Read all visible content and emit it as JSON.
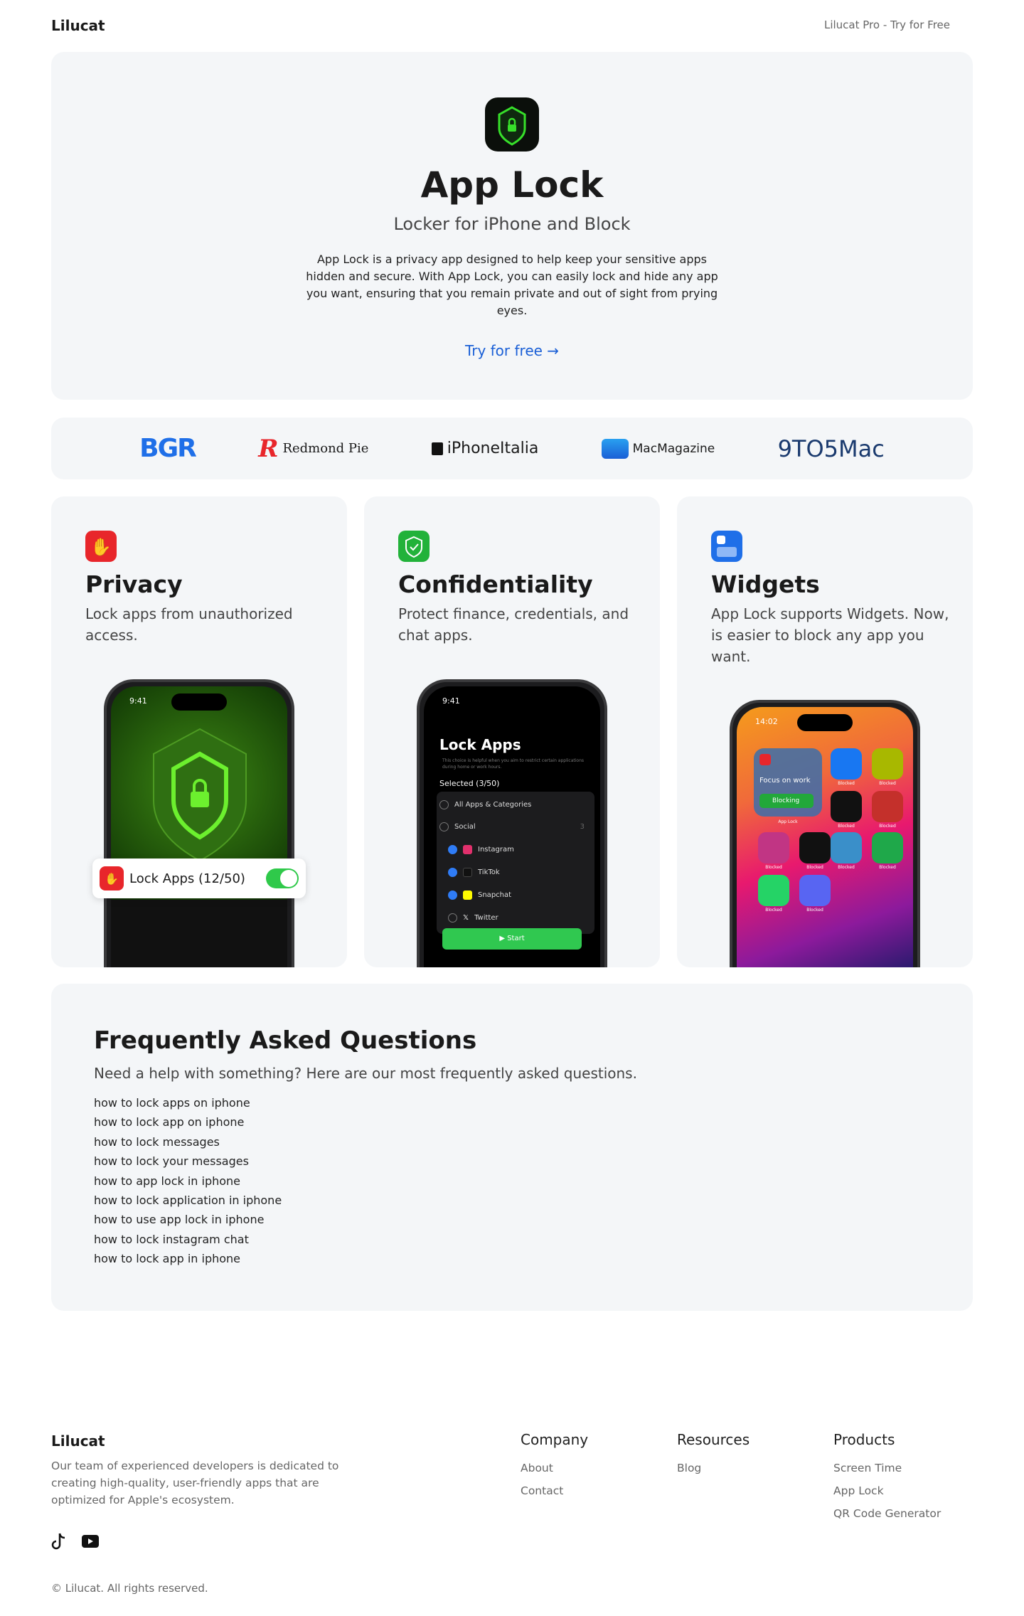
{
  "header": {
    "brand": "Lilucat",
    "pro_link": "Lilucat Pro - Try for Free"
  },
  "hero": {
    "title": "App Lock",
    "subtitle": "Locker for iPhone and Block",
    "description": "App Lock is a privacy app designed to help keep your sensitive apps hidden and secure. With App Lock, you can easily lock and hide any app you want, ensuring that you remain private and out of sight from prying eyes.",
    "cta": "Try for free →",
    "icon": "shield-lock-icon",
    "accent": "#1a5fd6"
  },
  "press_logos": [
    "BGR",
    "Redmond Pie",
    "iPhoneItalia",
    "MacMagazine",
    "9TO5Mac"
  ],
  "features": [
    {
      "title": "Privacy",
      "description": "Lock apps from unauthorized access.",
      "icon": "hand-stop-icon",
      "color": "#e8262b",
      "phone": {
        "time": "9:41",
        "toggle_label": "Lock Apps (12/50)",
        "toggle_on": true
      }
    },
    {
      "title": "Confidentiality",
      "description": "Protect finance, credentials, and chat apps.",
      "icon": "shield-check-icon",
      "color": "#22b23a",
      "phone": {
        "time": "9:41",
        "heading": "Lock Apps",
        "note": "This choice is helpful when you aim to restrict certain applications during home or work hours.",
        "selected": "Selected (3/50)",
        "rows": [
          {
            "label": "All Apps & Categories",
            "checked": false
          },
          {
            "label": "Social",
            "count": "3",
            "checked": false
          },
          {
            "label": "Instagram",
            "checked": true
          },
          {
            "label": "TikTok",
            "checked": true
          },
          {
            "label": "Snapchat",
            "checked": true
          },
          {
            "label": "Twitter",
            "checked": false
          }
        ],
        "start": "▶ Start"
      }
    },
    {
      "title": "Widgets",
      "description": "App Lock supports Widgets. Now, is easier to block any app you want.",
      "icon": "widget-icon",
      "color": "#1f6fe8",
      "phone": {
        "time": "14:02",
        "widget_title": "Focus on work",
        "widget_button": "Blocking",
        "widget_caption": "App Lock",
        "blocked_label": "Blocked"
      }
    }
  ],
  "faq": {
    "title": "Frequently Asked Questions",
    "subtitle": "Need a help with something? Here are our most frequently asked questions.",
    "items": [
      "how to lock apps on iphone",
      "how to lock app on iphone",
      "how to lock messages",
      "how to lock your messages",
      "how to app lock in iphone",
      "how to lock application in iphone",
      "how to use app lock in iphone",
      "how to lock instagram chat",
      "how to lock app in iphone"
    ]
  },
  "footer": {
    "brand": "Lilucat",
    "description": "Our team of experienced developers is dedicated to creating high-quality, user-friendly apps that are optimized for Apple's ecosystem.",
    "columns": [
      {
        "title": "Company",
        "links": [
          "About",
          "Contact"
        ]
      },
      {
        "title": "Resources",
        "links": [
          "Blog"
        ]
      },
      {
        "title": "Products",
        "links": [
          "Screen Time",
          "App Lock",
          "QR Code Generator"
        ]
      }
    ],
    "social": [
      "tiktok-icon",
      "youtube-icon"
    ],
    "copyright": "© Lilucat. All rights reserved."
  }
}
